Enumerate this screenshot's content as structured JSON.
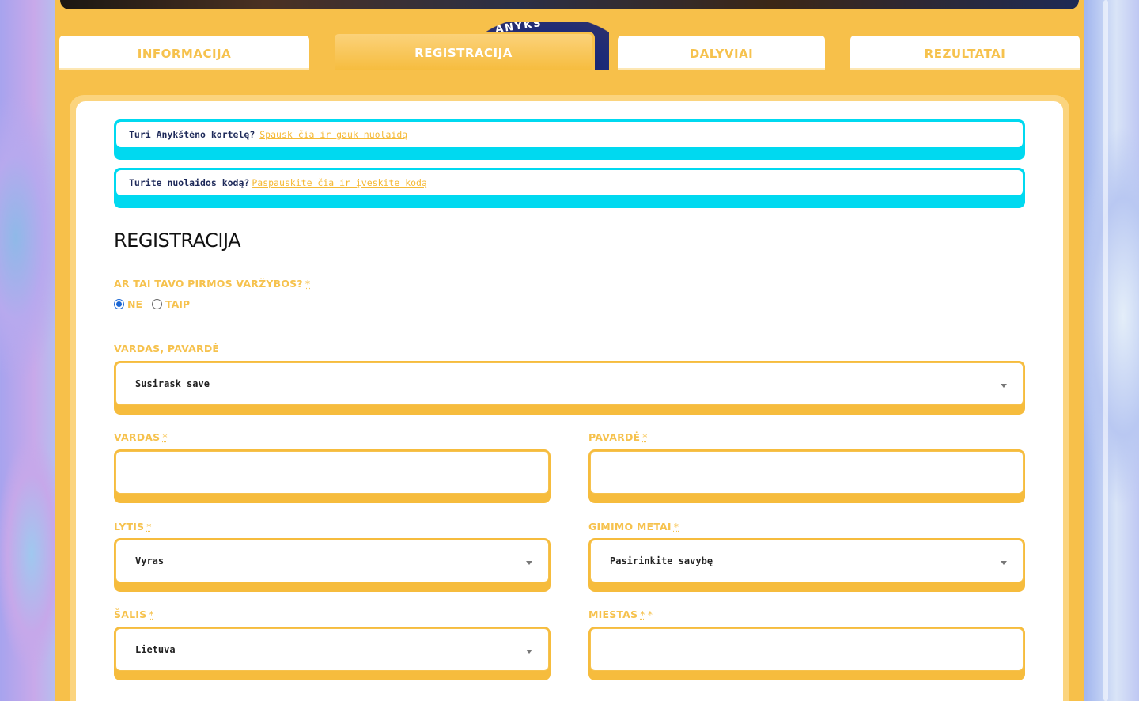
{
  "tabs": [
    {
      "label": "INFORMACIJA",
      "active": false
    },
    {
      "label": "REGISTRACIJA",
      "active": true
    },
    {
      "label": "DALYVIAI",
      "active": false
    },
    {
      "label": "REZULTATAI",
      "active": false
    }
  ],
  "notices": [
    {
      "text": "Turi Anykštėno kortelę?",
      "link": "Spausk čia ir gauk nuolaidą"
    },
    {
      "text": "Turite nuolaidos kodą?",
      "link": "Paspauskite čia ir įveskite kodą"
    }
  ],
  "form": {
    "title": "REGISTRACIJA",
    "required_mark": "*",
    "first_race": {
      "label": "AR TAI TAVO PIRMOS VARŽYBOS?",
      "options": [
        "NE",
        "TAIP"
      ],
      "selected": "NE"
    },
    "full_name": {
      "label": "VARDAS, PAVARDĖ",
      "value": "Susirask save"
    },
    "first_name": {
      "label": "VARDAS",
      "value": ""
    },
    "last_name": {
      "label": "PAVARDĖ",
      "value": ""
    },
    "gender": {
      "label": "LYTIS",
      "value": "Vyras"
    },
    "birth_year": {
      "label": "GIMIMO METAI",
      "value": "Pasirinkite savybę"
    },
    "country": {
      "label": "ŠALIS",
      "value": "Lietuva"
    },
    "city": {
      "label": "MIESTAS",
      "required_mark2": "*",
      "value": ""
    }
  },
  "colors": {
    "accent": "#f6c24e",
    "notice_border": "#00d9f0",
    "frame": "#f7c04a"
  }
}
